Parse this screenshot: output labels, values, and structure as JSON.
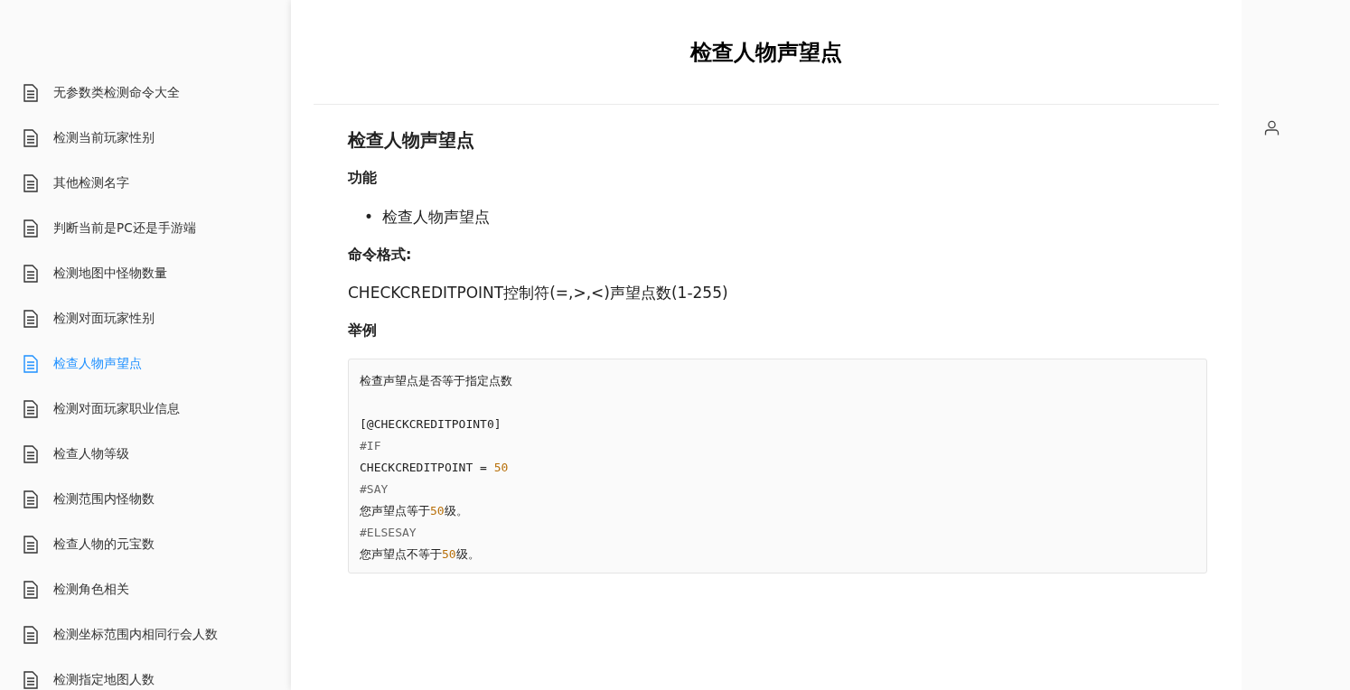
{
  "sidebar": {
    "items": [
      {
        "label": "无参数类检测命令大全",
        "selected": false
      },
      {
        "label": "检测当前玩家性别",
        "selected": false
      },
      {
        "label": "其他检测名字",
        "selected": false
      },
      {
        "label": "判断当前是PC还是手游端",
        "selected": false
      },
      {
        "label": "检测地图中怪物数量",
        "selected": false
      },
      {
        "label": "检测对面玩家性别",
        "selected": false
      },
      {
        "label": "检查人物声望点",
        "selected": true
      },
      {
        "label": "检测对面玩家职业信息",
        "selected": false
      },
      {
        "label": "检查人物等级",
        "selected": false
      },
      {
        "label": "检测范围内怪物数",
        "selected": false
      },
      {
        "label": "检查人物的元宝数",
        "selected": false
      },
      {
        "label": "检测角色相关",
        "selected": false
      },
      {
        "label": "检测坐标范围内相同行会人数",
        "selected": false
      },
      {
        "label": "检测指定地图人数",
        "selected": false
      }
    ]
  },
  "page_title": "检查人物声望点",
  "article": {
    "heading": "检查人物声望点",
    "blocks": [
      {
        "kind": "subheading",
        "text": "功能"
      },
      {
        "kind": "bullet",
        "marker": "•",
        "text": "检查人物声望点"
      },
      {
        "kind": "subheading",
        "text": "命令格式:"
      },
      {
        "kind": "paragraph",
        "text": "CHECKCREDITPOINT控制符(=,>,<)声望点数(1-255)"
      },
      {
        "kind": "subheading",
        "text": "举例"
      }
    ],
    "code": [
      {
        "kind": "text",
        "segments": [
          {
            "kind": "plain",
            "text": "检查声望点是否等于指定点数"
          }
        ]
      },
      {
        "kind": "blank"
      },
      {
        "kind": "text",
        "segments": [
          {
            "kind": "plain",
            "text": "[@CHECKCREDITPOINT0]"
          }
        ]
      },
      {
        "kind": "text",
        "segments": [
          {
            "kind": "keyword",
            "text": "#IF"
          }
        ]
      },
      {
        "kind": "text",
        "segments": [
          {
            "kind": "plain",
            "text": "CHECKCREDITPOINT = "
          },
          {
            "kind": "number",
            "text": "50"
          }
        ]
      },
      {
        "kind": "text",
        "segments": [
          {
            "kind": "keyword",
            "text": "#SAY"
          }
        ]
      },
      {
        "kind": "text",
        "segments": [
          {
            "kind": "plain",
            "text": "您声望点等于"
          },
          {
            "kind": "number",
            "text": "50"
          },
          {
            "kind": "plain",
            "text": "级。"
          }
        ]
      },
      {
        "kind": "text",
        "segments": [
          {
            "kind": "keyword",
            "text": "#ELSESAY"
          }
        ]
      },
      {
        "kind": "text",
        "segments": [
          {
            "kind": "plain",
            "text": "您声望点不等于"
          },
          {
            "kind": "number",
            "text": "50"
          },
          {
            "kind": "plain",
            "text": "级。"
          }
        ]
      }
    ]
  }
}
